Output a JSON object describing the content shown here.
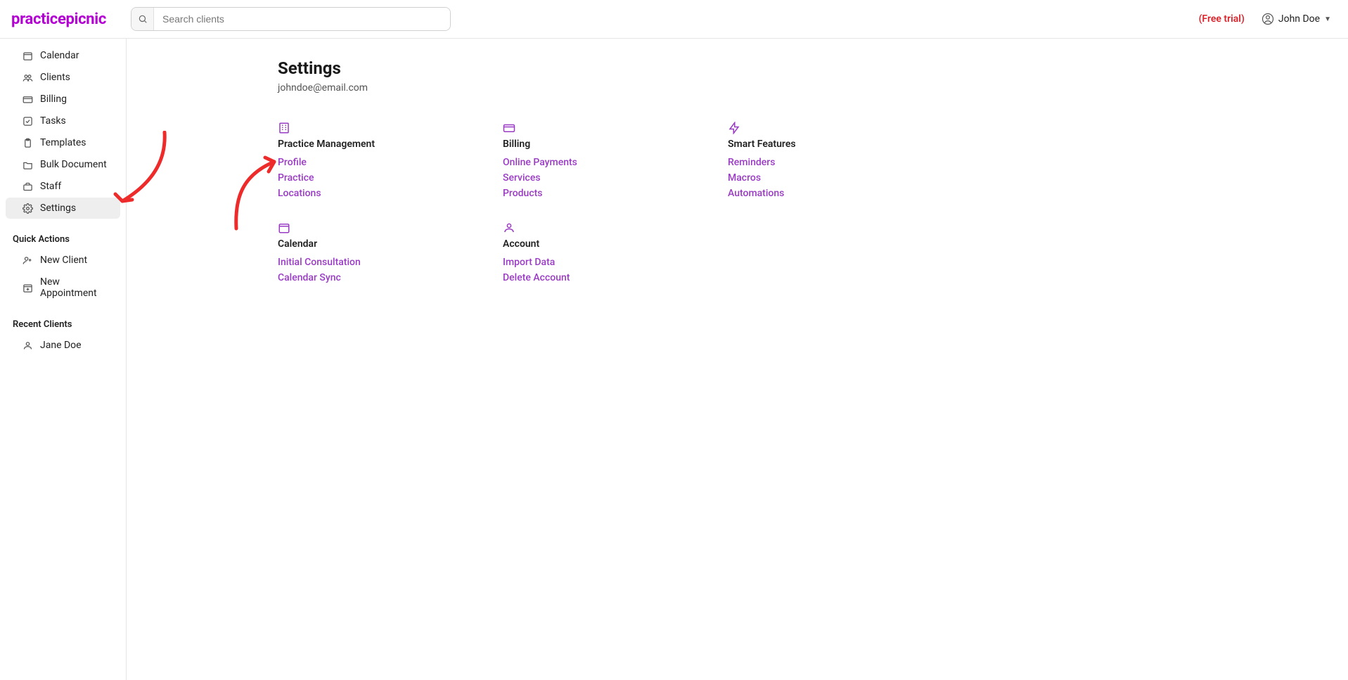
{
  "logo": "practicepicnic",
  "search_placeholder": "Search clients",
  "trial_label": "(Free trial)",
  "user_name": "John Doe",
  "sidebar": {
    "nav": [
      {
        "label": "Calendar",
        "icon": "calendar"
      },
      {
        "label": "Clients",
        "icon": "clients"
      },
      {
        "label": "Billing",
        "icon": "billing"
      },
      {
        "label": "Tasks",
        "icon": "tasks"
      },
      {
        "label": "Templates",
        "icon": "templates"
      },
      {
        "label": "Bulk Document",
        "icon": "folder"
      },
      {
        "label": "Staff",
        "icon": "staff"
      },
      {
        "label": "Settings",
        "icon": "settings",
        "active": true
      }
    ],
    "quick_actions_label": "Quick Actions",
    "quick_actions": [
      {
        "label": "New Client",
        "icon": "new-client"
      },
      {
        "label": "New Appointment",
        "icon": "new-appointment"
      }
    ],
    "recent_clients_label": "Recent Clients",
    "recent_clients": [
      {
        "label": "Jane Doe",
        "icon": "person"
      }
    ]
  },
  "page": {
    "title": "Settings",
    "subtitle": "johndoe@email.com"
  },
  "settings_sections": [
    {
      "title": "Practice Management",
      "icon": "building",
      "links": [
        "Profile",
        "Practice",
        "Locations"
      ]
    },
    {
      "title": "Billing",
      "icon": "card",
      "links": [
        "Online Payments",
        "Services",
        "Products"
      ]
    },
    {
      "title": "Smart Features",
      "icon": "bolt",
      "links": [
        "Reminders",
        "Macros",
        "Automations"
      ]
    },
    {
      "title": "Calendar",
      "icon": "calendar",
      "links": [
        "Initial Consultation",
        "Calendar Sync"
      ]
    },
    {
      "title": "Account",
      "icon": "account",
      "links": [
        "Import Data",
        "Delete Account"
      ]
    }
  ]
}
